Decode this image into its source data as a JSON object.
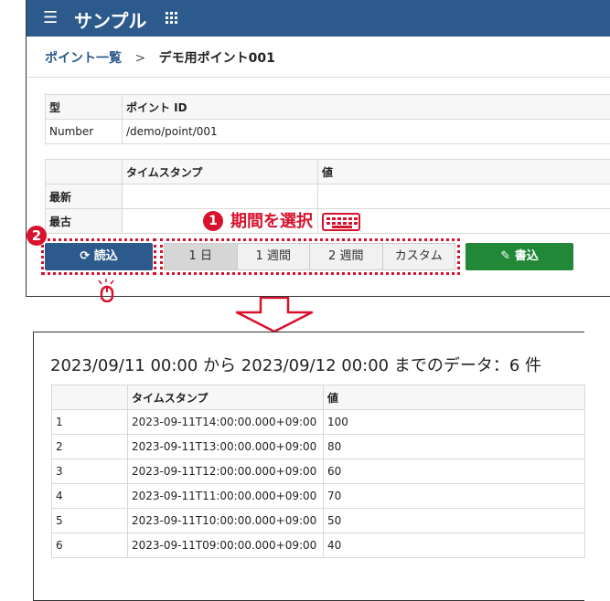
{
  "app": {
    "title": "サンプル",
    "menu_icon": "hamburger-icon",
    "apps_icon": "grid-icon"
  },
  "breadcrumb": {
    "parent": "ポイント一覧",
    "separator": ">",
    "current": "デモ用ポイント001"
  },
  "point_info": {
    "headers": [
      "型",
      "ポイント ID"
    ],
    "row": [
      "Number",
      "/demo/point/001"
    ]
  },
  "latest_table": {
    "headers": [
      "",
      "タイムスタンプ",
      "値"
    ],
    "rows": [
      [
        "最新",
        "",
        ""
      ],
      [
        "最古",
        "",
        ""
      ]
    ]
  },
  "annotations": {
    "step1_number": "1",
    "step1_text": "期間を選択",
    "step2_number": "2"
  },
  "buttons": {
    "read": "読込",
    "write": "書込"
  },
  "period_options": [
    "1 日",
    "1 週間",
    "2 週間",
    "カスタム"
  ],
  "result": {
    "summary": "2023/09/11 00:00 から 2023/09/12 00:00 までのデータ：6 件",
    "headers": [
      "",
      "タイムスタンプ",
      "値"
    ],
    "rows": [
      [
        "1",
        "2023-09-11T14:00:00.000+09:00",
        "100"
      ],
      [
        "2",
        "2023-09-11T13:00:00.000+09:00",
        "80"
      ],
      [
        "3",
        "2023-09-11T12:00:00.000+09:00",
        "60"
      ],
      [
        "4",
        "2023-09-11T11:00:00.000+09:00",
        "70"
      ],
      [
        "5",
        "2023-09-11T10:00:00.000+09:00",
        "50"
      ],
      [
        "6",
        "2023-09-11T09:00:00.000+09:00",
        "40"
      ]
    ]
  },
  "colors": {
    "brand": "#2c5a8c",
    "annotation": "#d8122d",
    "write_button": "#218838"
  }
}
